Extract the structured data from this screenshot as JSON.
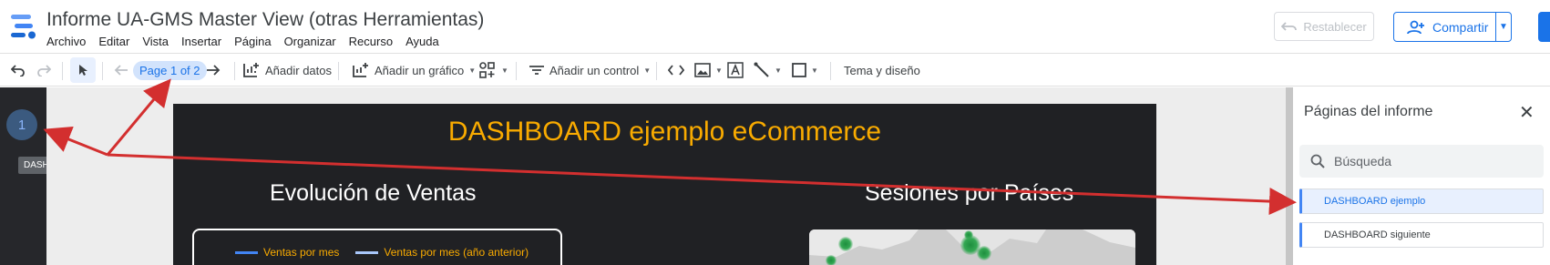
{
  "app": {
    "title": "Informe UA-GMS Master View (otras Herramientas)",
    "menu": [
      "Archivo",
      "Editar",
      "Vista",
      "Insertar",
      "Página",
      "Organizar",
      "Recurso",
      "Ayuda"
    ],
    "reset_label": "Restablecer",
    "share_label": "Compartir"
  },
  "toolbar": {
    "page_indicator": "Page 1 of 2",
    "add_data": "Añadir datos",
    "add_chart": "Añadir un gráfico",
    "add_control": "Añadir un control",
    "theme": "Tema y diseño"
  },
  "left_rail": {
    "page_number": "1",
    "tooltip": "DASHBOARD ejemplo"
  },
  "report": {
    "title": "DASHBOARD ejemplo eCommerce",
    "chart1_title": "Evolución de Ventas",
    "chart2_title": "Sesiones por Países",
    "legend": [
      {
        "label": "Ventas por mes",
        "color": "#4285f4"
      },
      {
        "label": "Ventas por mes (año anterior)",
        "color": "#a8c7fa"
      }
    ]
  },
  "panel": {
    "title": "Páginas del informe",
    "search_placeholder": "Búsqueda",
    "pages": [
      "DASHBOARD ejemplo",
      "DASHBOARD siguiente"
    ]
  },
  "colors": {
    "accent": "#1a73e8",
    "report_bg": "#202124",
    "report_title": "#f9ab00",
    "annotation_arrow": "#d32f2f"
  }
}
